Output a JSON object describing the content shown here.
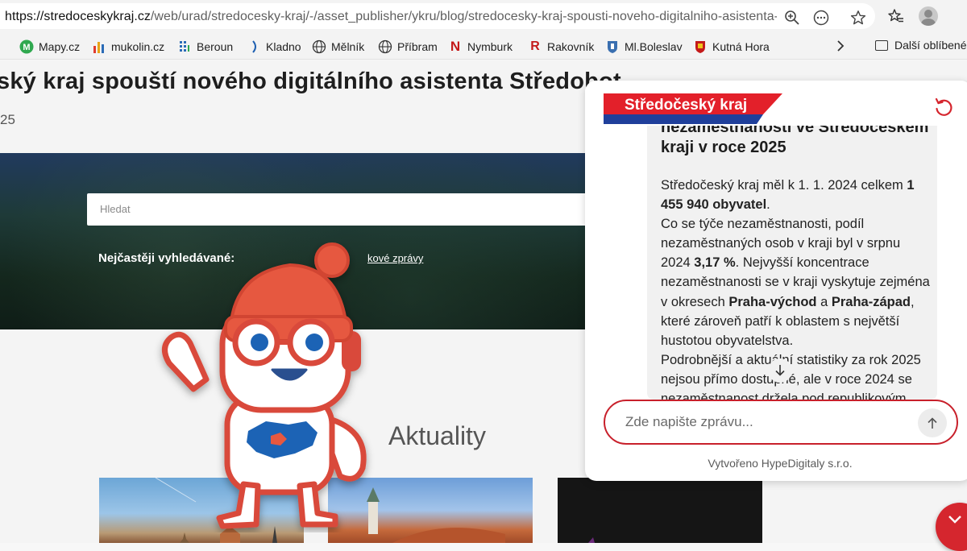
{
  "browser": {
    "url_host": "https://stredoceskykraj.cz",
    "url_path": "/web/urad/stredocesky-kraj/-/asset_publisher/ykru/blog/stredocesky-kraj-spousti-noveho-digitalniho-asistenta-...",
    "url_icons": [
      "zoom-icon",
      "more-options-icon",
      "favorite-star-icon"
    ],
    "favorites": [
      {
        "label": "Mapy.cz",
        "icon": "mapy-icon",
        "color": "#2fa84f"
      },
      {
        "label": "mukolin.cz",
        "icon": "mukolin-icon",
        "color": "#e8a317"
      },
      {
        "label": "Beroun",
        "icon": "beroun-icon",
        "color": "#2a6bb6"
      },
      {
        "label": "Kladno",
        "icon": "kladno-icon",
        "color": "#1d5fb1"
      },
      {
        "label": "Mělník",
        "icon": "globe-icon",
        "color": "#333333"
      },
      {
        "label": "Příbram",
        "icon": "globe-icon",
        "color": "#333333"
      },
      {
        "label": "Nymburk",
        "icon": "nymburk-icon",
        "color": "#c41a1a"
      },
      {
        "label": "Rakovník",
        "icon": "rakovnik-icon",
        "color": "#c41a1a"
      },
      {
        "label": "Ml.Boleslav",
        "icon": "mlboleslav-icon",
        "color": "#3a6fb0"
      },
      {
        "label": "Kutná Hora",
        "icon": "kutnahora-icon",
        "color": "#c41a1a"
      }
    ],
    "other_favorites": "Další oblíbené p"
  },
  "page": {
    "title": "ský kraj spouští nového digitálního asistenta Středobot",
    "date": "25",
    "search_placeholder": "Hledat",
    "most_searched_label": "Nejčastěji vyhledávané:",
    "most_searched_link": "kové zprávy",
    "section_title": "Aktuality"
  },
  "chat": {
    "logo_text": "Středočeský kraj",
    "heading": "nezaměstnanosti ve Středočeském kraji v roce 2025",
    "input_placeholder": "Zde napište zprávu...",
    "footer": "Vytvořeno HypeDigitaly s.r.o.",
    "colors": {
      "accent": "#d5262e",
      "logo_blue": "#1f3f9b",
      "logo_red": "#e3202a"
    }
  }
}
